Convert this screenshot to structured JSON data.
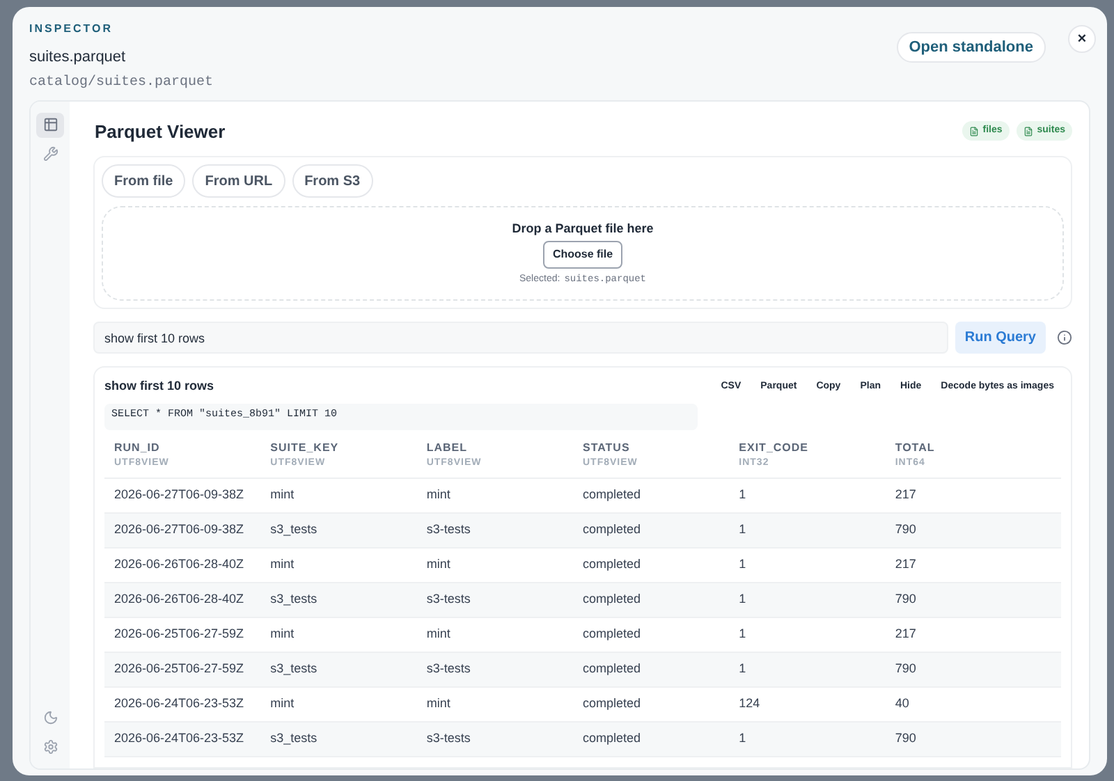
{
  "inspector": {
    "eyebrow": "INSPECTOR",
    "title": "suites.parquet",
    "path": "catalog/suites.parquet",
    "open_button": "Open standalone",
    "close_button": "×"
  },
  "viewer": {
    "title": "Parquet Viewer",
    "tags": [
      "files",
      "suites"
    ],
    "source_tabs": [
      {
        "label": "From file"
      },
      {
        "label": "From URL"
      },
      {
        "label": "From S3"
      }
    ],
    "dropzone": {
      "prompt": "Drop a Parquet file here",
      "button": "Choose file",
      "selected_label": "Selected:",
      "selected_file": "suites.parquet"
    },
    "query": {
      "value": "show first 10 rows",
      "run_button": "Run Query"
    },
    "results": {
      "title": "show first 10 rows",
      "actions": [
        "CSV",
        "Parquet",
        "Copy",
        "Plan",
        "Hide",
        "Decode bytes as images"
      ],
      "sql": "SELECT * FROM \"suites_8b91\" LIMIT 10",
      "columns": [
        {
          "name": "RUN_ID",
          "type": "UTF8VIEW"
        },
        {
          "name": "SUITE_KEY",
          "type": "UTF8VIEW"
        },
        {
          "name": "LABEL",
          "type": "UTF8VIEW"
        },
        {
          "name": "STATUS",
          "type": "UTF8VIEW"
        },
        {
          "name": "EXIT_CODE",
          "type": "INT32"
        },
        {
          "name": "TOTAL",
          "type": "INT64"
        }
      ],
      "rows": [
        [
          "2026-06-27T06-09-38Z",
          "mint",
          "mint",
          "completed",
          "1",
          "217"
        ],
        [
          "2026-06-27T06-09-38Z",
          "s3_tests",
          "s3-tests",
          "completed",
          "1",
          "790"
        ],
        [
          "2026-06-26T06-28-40Z",
          "mint",
          "mint",
          "completed",
          "1",
          "217"
        ],
        [
          "2026-06-26T06-28-40Z",
          "s3_tests",
          "s3-tests",
          "completed",
          "1",
          "790"
        ],
        [
          "2026-06-25T06-27-59Z",
          "mint",
          "mint",
          "completed",
          "1",
          "217"
        ],
        [
          "2026-06-25T06-27-59Z",
          "s3_tests",
          "s3-tests",
          "completed",
          "1",
          "790"
        ],
        [
          "2026-06-24T06-23-53Z",
          "mint",
          "mint",
          "completed",
          "124",
          "40"
        ],
        [
          "2026-06-24T06-23-53Z",
          "s3_tests",
          "s3-tests",
          "completed",
          "1",
          "790"
        ]
      ]
    }
  }
}
